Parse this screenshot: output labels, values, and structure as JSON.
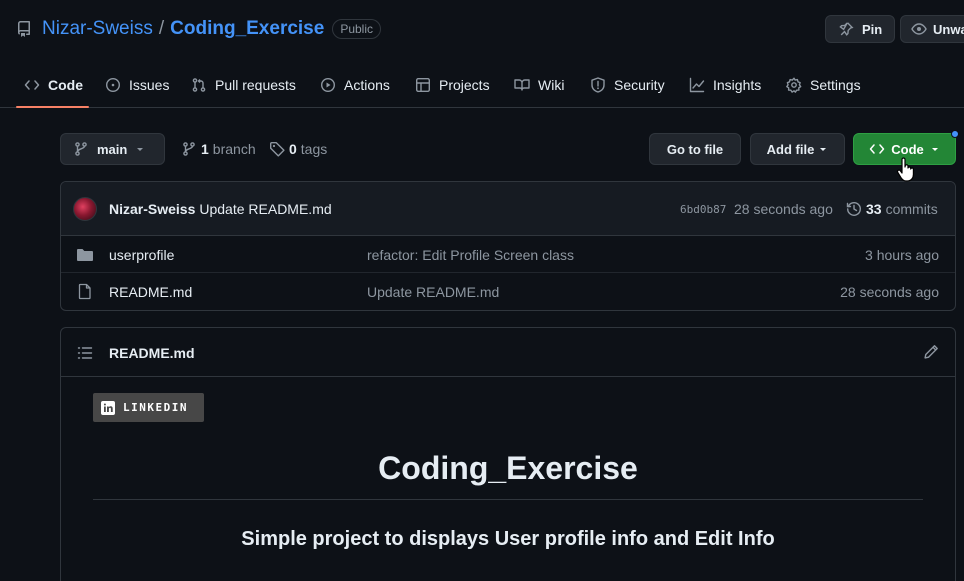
{
  "repo": {
    "owner": "Nizar-Sweiss",
    "separator": "/",
    "name": "Coding_Exercise",
    "visibility": "Public"
  },
  "header_actions": {
    "pin_label": "Pin",
    "watch_label": "Unwa"
  },
  "tabs": [
    {
      "label": "Code",
      "icon": "code-icon",
      "active": true
    },
    {
      "label": "Issues",
      "icon": "issue-icon"
    },
    {
      "label": "Pull requests",
      "icon": "pull-request-icon"
    },
    {
      "label": "Actions",
      "icon": "play-icon"
    },
    {
      "label": "Projects",
      "icon": "table-icon"
    },
    {
      "label": "Wiki",
      "icon": "book-icon"
    },
    {
      "label": "Security",
      "icon": "shield-icon"
    },
    {
      "label": "Insights",
      "icon": "graph-icon"
    },
    {
      "label": "Settings",
      "icon": "gear-icon"
    }
  ],
  "toolbar": {
    "branch": "main",
    "branch_count": "1",
    "branch_label": "branch",
    "tag_count": "0",
    "tag_label": "tags",
    "goto_file": "Go to file",
    "add_file": "Add file",
    "code": "Code"
  },
  "latest_commit": {
    "author": "Nizar-Sweiss",
    "message": "Update README.md",
    "sha": "6bd0b87",
    "time": "28 seconds ago",
    "commit_count": "33",
    "commit_label": "commits"
  },
  "files": [
    {
      "type": "folder",
      "name": "userprofile",
      "message": "refactor: Edit Profile Screen class",
      "time": "3 hours ago"
    },
    {
      "type": "file",
      "name": "README.md",
      "message": "Update README.md",
      "time": "28 seconds ago"
    }
  ],
  "readme": {
    "filename": "README.md",
    "badge": "LINKEDIN",
    "title": "Coding_Exercise",
    "subtitle": "Simple project to displays User profile info and Edit Info"
  },
  "colors": {
    "background": "#0d1117",
    "link": "#4493f8",
    "primary_button": "#238636",
    "tab_underline": "#f78166"
  }
}
